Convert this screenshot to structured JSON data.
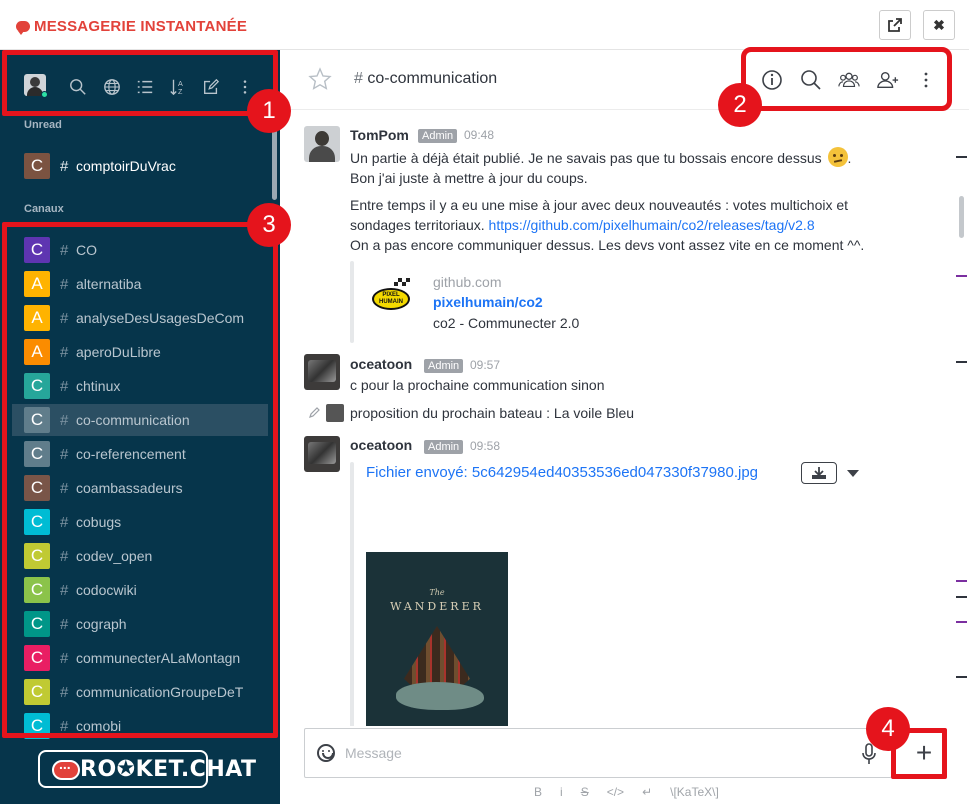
{
  "app": {
    "title": "MESSAGERIE INSTANTANÉE",
    "external_icon": "external-link-icon",
    "close_label": "✖"
  },
  "sidebar": {
    "sections": {
      "unread": "Unread",
      "channels": "Canaux"
    },
    "unread_rooms": [
      {
        "letter": "C",
        "name": "comptoirDuVrac",
        "color": "#7b5341"
      }
    ],
    "channels": [
      {
        "letter": "C",
        "name": "CO",
        "color": "#5e35b1"
      },
      {
        "letter": "A",
        "name": "alternatiba",
        "color": "#ffb300"
      },
      {
        "letter": "A",
        "name": "analyseDesUsagesDeCom",
        "color": "#ffb300"
      },
      {
        "letter": "A",
        "name": "aperoDuLibre",
        "color": "#fb8c00"
      },
      {
        "letter": "C",
        "name": "chtinux",
        "color": "#26a69a"
      },
      {
        "letter": "C",
        "name": "co-communication",
        "color": "#607d8b"
      },
      {
        "letter": "C",
        "name": "co-referencement",
        "color": "#607d8b"
      },
      {
        "letter": "C",
        "name": "coambassadeurs",
        "color": "#795548"
      },
      {
        "letter": "C",
        "name": "cobugs",
        "color": "#00bcd4"
      },
      {
        "letter": "C",
        "name": "codev_open",
        "color": "#c0ca33"
      },
      {
        "letter": "C",
        "name": "codocwiki",
        "color": "#8bc34a"
      },
      {
        "letter": "C",
        "name": "cograph",
        "color": "#009688"
      },
      {
        "letter": "C",
        "name": "communecterALaMontagn",
        "color": "#e91e63"
      },
      {
        "letter": "C",
        "name": "communicationGroupeDeT",
        "color": "#c0ca33"
      },
      {
        "letter": "C",
        "name": "comobi",
        "color": "#00bcd4"
      }
    ],
    "logo_text": "RO✪KET.CHAT"
  },
  "header": {
    "room_title": "co-communication"
  },
  "messages": [
    {
      "user": "TomPom",
      "role": "Admin",
      "time": "09:48",
      "lines": [
        "Un partie à déjà était publié. Je ne savais pas que tu bossais encore dessus",
        "Bon j'ai juste à mettre à jour du coups.",
        "Entre temps il y a eu une mise à jour avec deux nouveautés : votes multichoix et",
        "sondages territoriaux.",
        "https://github.com/pixelhumain/co2/releases/tag/v2.8",
        "On a pas encore communiquer dessus. Les devs vont assez vite en ce moment ^^."
      ],
      "preview": {
        "site": "github.com",
        "title": "pixelhumain/co2",
        "description": "co2 - Communecter 2.0",
        "logo_text": "PIXEL HUMAIN"
      }
    },
    {
      "user": "oceatoon",
      "role": "Admin",
      "time": "09:57",
      "lines": [
        "c pour la prochaine communication sinon",
        "proposition du prochain bateau : La voile Bleu"
      ]
    },
    {
      "user": "oceatoon",
      "role": "Admin",
      "time": "09:58",
      "file": "Fichier envoyé: 5c642954ed40353536ed047330f37980.jpg",
      "poster_sub": "The",
      "poster_title": "WANDERER"
    }
  ],
  "composer": {
    "placeholder": "Message",
    "send_label": "+"
  },
  "formatting": [
    "B",
    "i",
    "S",
    "</>",
    "↵",
    "\\[KaTeX\\]"
  ],
  "annotations": [
    "1",
    "2",
    "3",
    "4"
  ],
  "colors": {
    "sidebar_bg": "#06354b",
    "accent_red": "#e2423a",
    "annotation_red": "#e5141c",
    "link_blue": "#1d74f5"
  }
}
